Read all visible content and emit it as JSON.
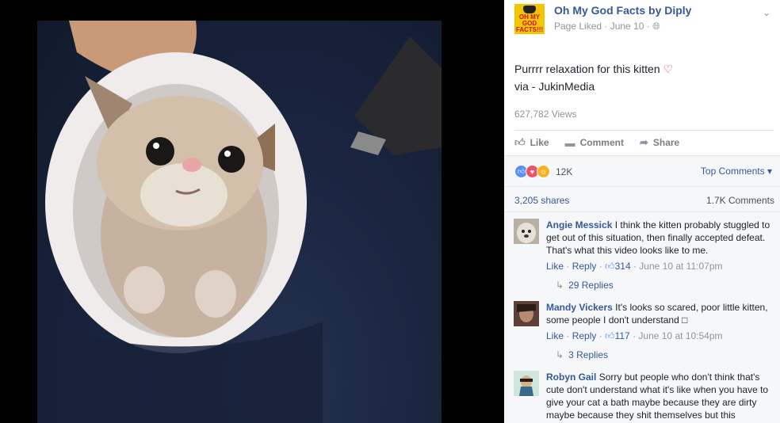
{
  "page": {
    "name": "Oh My God Facts by Diply",
    "logo_text": "OH MY GOD FACTS!!!",
    "meta": "Page Liked · June 10 · "
  },
  "post": {
    "line1": "Purrrr relaxation for this kitten",
    "line2": "via - JukinMedia",
    "views": "627,782 Views"
  },
  "actions": {
    "like": "Like",
    "comment": "Comment",
    "share": "Share"
  },
  "reactions": {
    "count": "12K",
    "top_comments": "Top Comments"
  },
  "stats": {
    "shares": "3,205 shares",
    "comments": "1.7K Comments"
  },
  "comments": [
    {
      "author": "Angie Messick",
      "text": "I think the kitten probably stuggled to get out of this situation, then finally accepted defeat. That's what this video looks like to me.",
      "like": "Like",
      "reply": "Reply",
      "likes": "314",
      "time": "June 10 at 11:07pm",
      "replies": "29 Replies"
    },
    {
      "author": "Mandy Vickers",
      "text": "It's looks so scared, poor little kitten, some people I don't understand",
      "like": "Like",
      "reply": "Reply",
      "likes": "117",
      "time": "June 10 at 10:54pm",
      "replies": "3 Replies"
    },
    {
      "author": "Robyn Gail",
      "text": "Sorry but people who don't think that's cute don't understand what it's like when you have to give your cat a bath maybe because they are dirty maybe because they shit themselves but this"
    }
  ],
  "colors": {
    "link": "#365899",
    "meta": "#90949c",
    "like_reaction": "#5890ff",
    "love_reaction": "#f25268",
    "haha_reaction": "#f7b125"
  }
}
